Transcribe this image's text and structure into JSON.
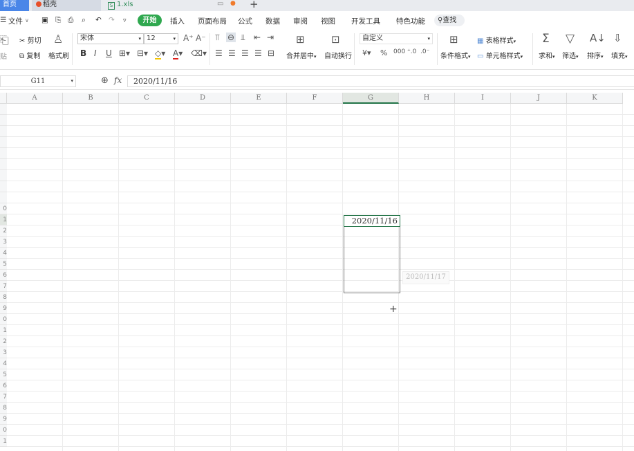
{
  "tabs": {
    "home": "首页",
    "daoke": "稻壳",
    "file": "1.xls"
  },
  "menu": {
    "file": "文件",
    "start": "开始",
    "items": [
      "插入",
      "页面布局",
      "公式",
      "数据",
      "审阅",
      "视图",
      "开发工具",
      "特色功能"
    ],
    "search": "查找"
  },
  "ribbon": {
    "cut": "剪切",
    "copy": "复制",
    "paste_partial": "粘贴",
    "format_painter": "格式刷",
    "font_name": "宋体",
    "font_size": "12",
    "merge_center": "合并居中",
    "wrap_text": "自动换行",
    "number_format": "自定义",
    "conditional_format": "条件格式",
    "table_style": "表格样式",
    "cell_style": "单元格样式",
    "sum": "求和",
    "filter": "筛选",
    "sort": "排序",
    "fill": "填充"
  },
  "formula_bar": {
    "cell_ref": "G11",
    "fx": "fx",
    "value": "2020/11/16"
  },
  "grid": {
    "columns": [
      "A",
      "B",
      "C",
      "D",
      "E",
      "F",
      "G",
      "H",
      "I",
      "J",
      "K"
    ],
    "selected_column": "G",
    "row_labels": [
      "",
      "",
      "",
      "",
      "",
      "",
      "",
      "",
      "",
      "0",
      "1",
      "2",
      "3",
      "4",
      "5",
      "6",
      "7",
      "8",
      "9",
      "0",
      "1",
      "2",
      "3",
      "4",
      "5",
      "6",
      "7",
      "8",
      "9",
      "0",
      "1"
    ],
    "active_cell_value": "2020/11/16",
    "fill_preview": "2020/11/17"
  }
}
